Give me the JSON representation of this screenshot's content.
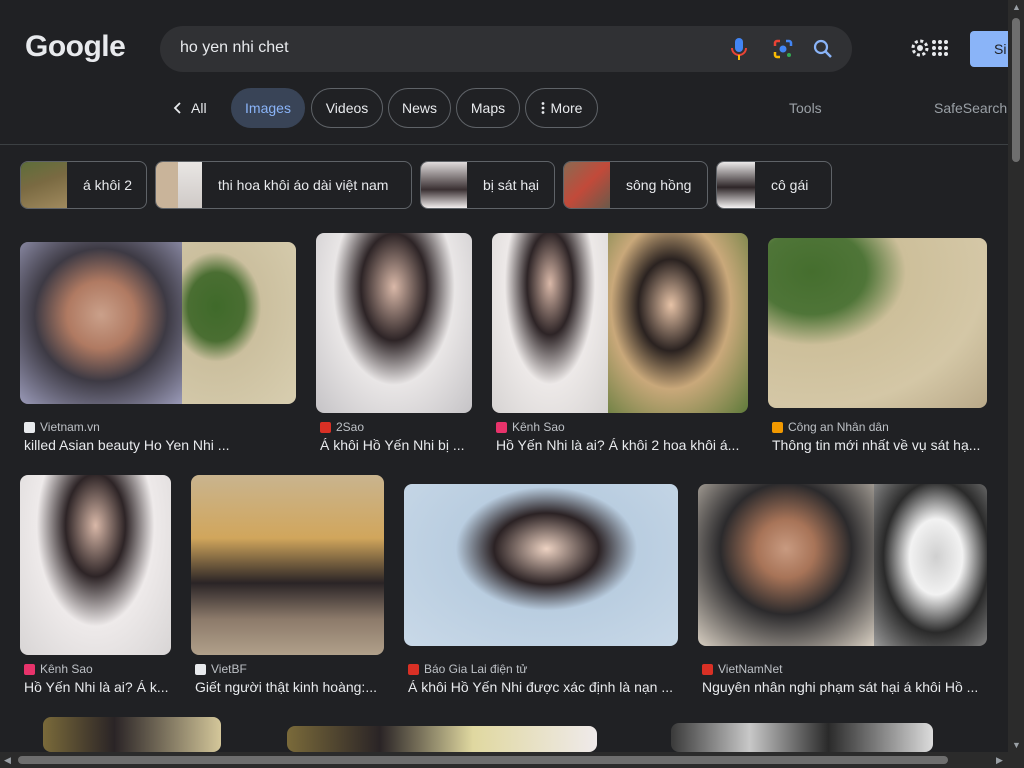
{
  "logo": "Google",
  "search": {
    "query": "ho yen nhi chet"
  },
  "signin": "Si",
  "nav": {
    "back_label": "All",
    "tabs": [
      {
        "label": "Images",
        "active": true
      },
      {
        "label": "Videos"
      },
      {
        "label": "News"
      },
      {
        "label": "Maps"
      },
      {
        "label": "More"
      }
    ],
    "tools": "Tools",
    "safesearch": "SafeSearch"
  },
  "suggestions": [
    "á khôi 2",
    "thi hoa khôi áo dài việt nam",
    "bị sát hại",
    "sông hồng",
    "cô gái"
  ],
  "results": [
    {
      "source": "Vietnam.vn",
      "title": "killed Asian beauty Ho Yen Nhi ...",
      "fav": "#e8eaed"
    },
    {
      "source": "2Sao",
      "title": "Á khôi Hồ Yến Nhi bị ...",
      "fav": "#d93025"
    },
    {
      "source": "Kênh Sao",
      "title": "Hồ Yến Nhi là ai? Á khôi 2 hoa khôi á...",
      "fav": "#e8336b"
    },
    {
      "source": "Công an Nhân dân",
      "title": "Thông tin mới nhất về vụ sát hạ...",
      "fav": "#f29900"
    },
    {
      "source": "Kênh Sao",
      "title": "Hồ Yến Nhi là ai? Á k...",
      "fav": "#e8336b"
    },
    {
      "source": "VietBF",
      "title": "Giết người thật kinh hoàng:...",
      "fav": "#e8eaed"
    },
    {
      "source": "Báo Gia Lai điện tử",
      "title": "Á khôi Hồ Yến Nhi được xác định là nạn ...",
      "fav": "#d93025"
    },
    {
      "source": "VietNamNet",
      "title": "Nguyên nhân nghi phạm sát hại á khôi Hồ ...",
      "fav": "#d93025"
    }
  ]
}
